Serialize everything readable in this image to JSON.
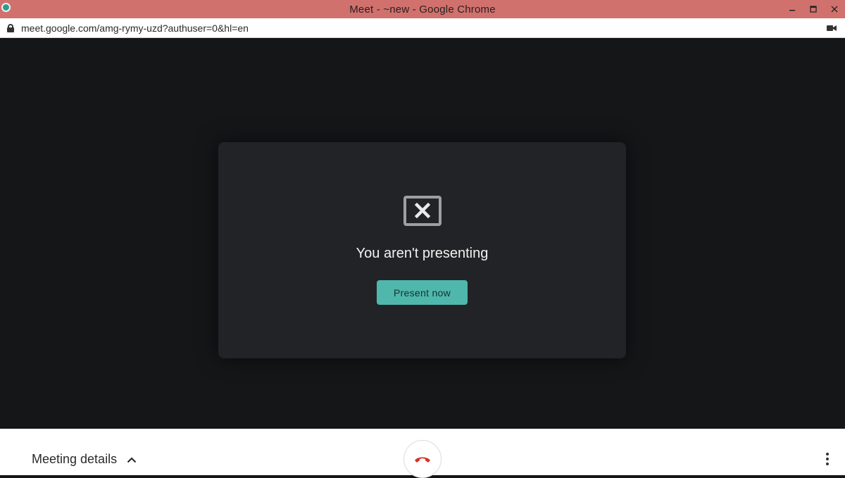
{
  "window": {
    "title": "Meet - ~new - Google Chrome",
    "controls": {
      "minimize": "–",
      "maximize": "□",
      "close": "✕"
    }
  },
  "address_bar": {
    "url": "meet.google.com/amg-rymy-uzd?authuser=0&hl=en"
  },
  "dialog": {
    "icon": "cancel-presentation-icon",
    "title": "You aren't presenting",
    "button_label": "Present now"
  },
  "bottom_bar": {
    "details_label": "Meeting details",
    "hangup_icon": "hangup-icon",
    "more_icon": "more-vert-icon"
  },
  "colors": {
    "titlebar": "#d0716d",
    "stage": "#151618",
    "dialog": "#222326",
    "accent": "#4fb7ac",
    "hangup": "#d93025"
  }
}
